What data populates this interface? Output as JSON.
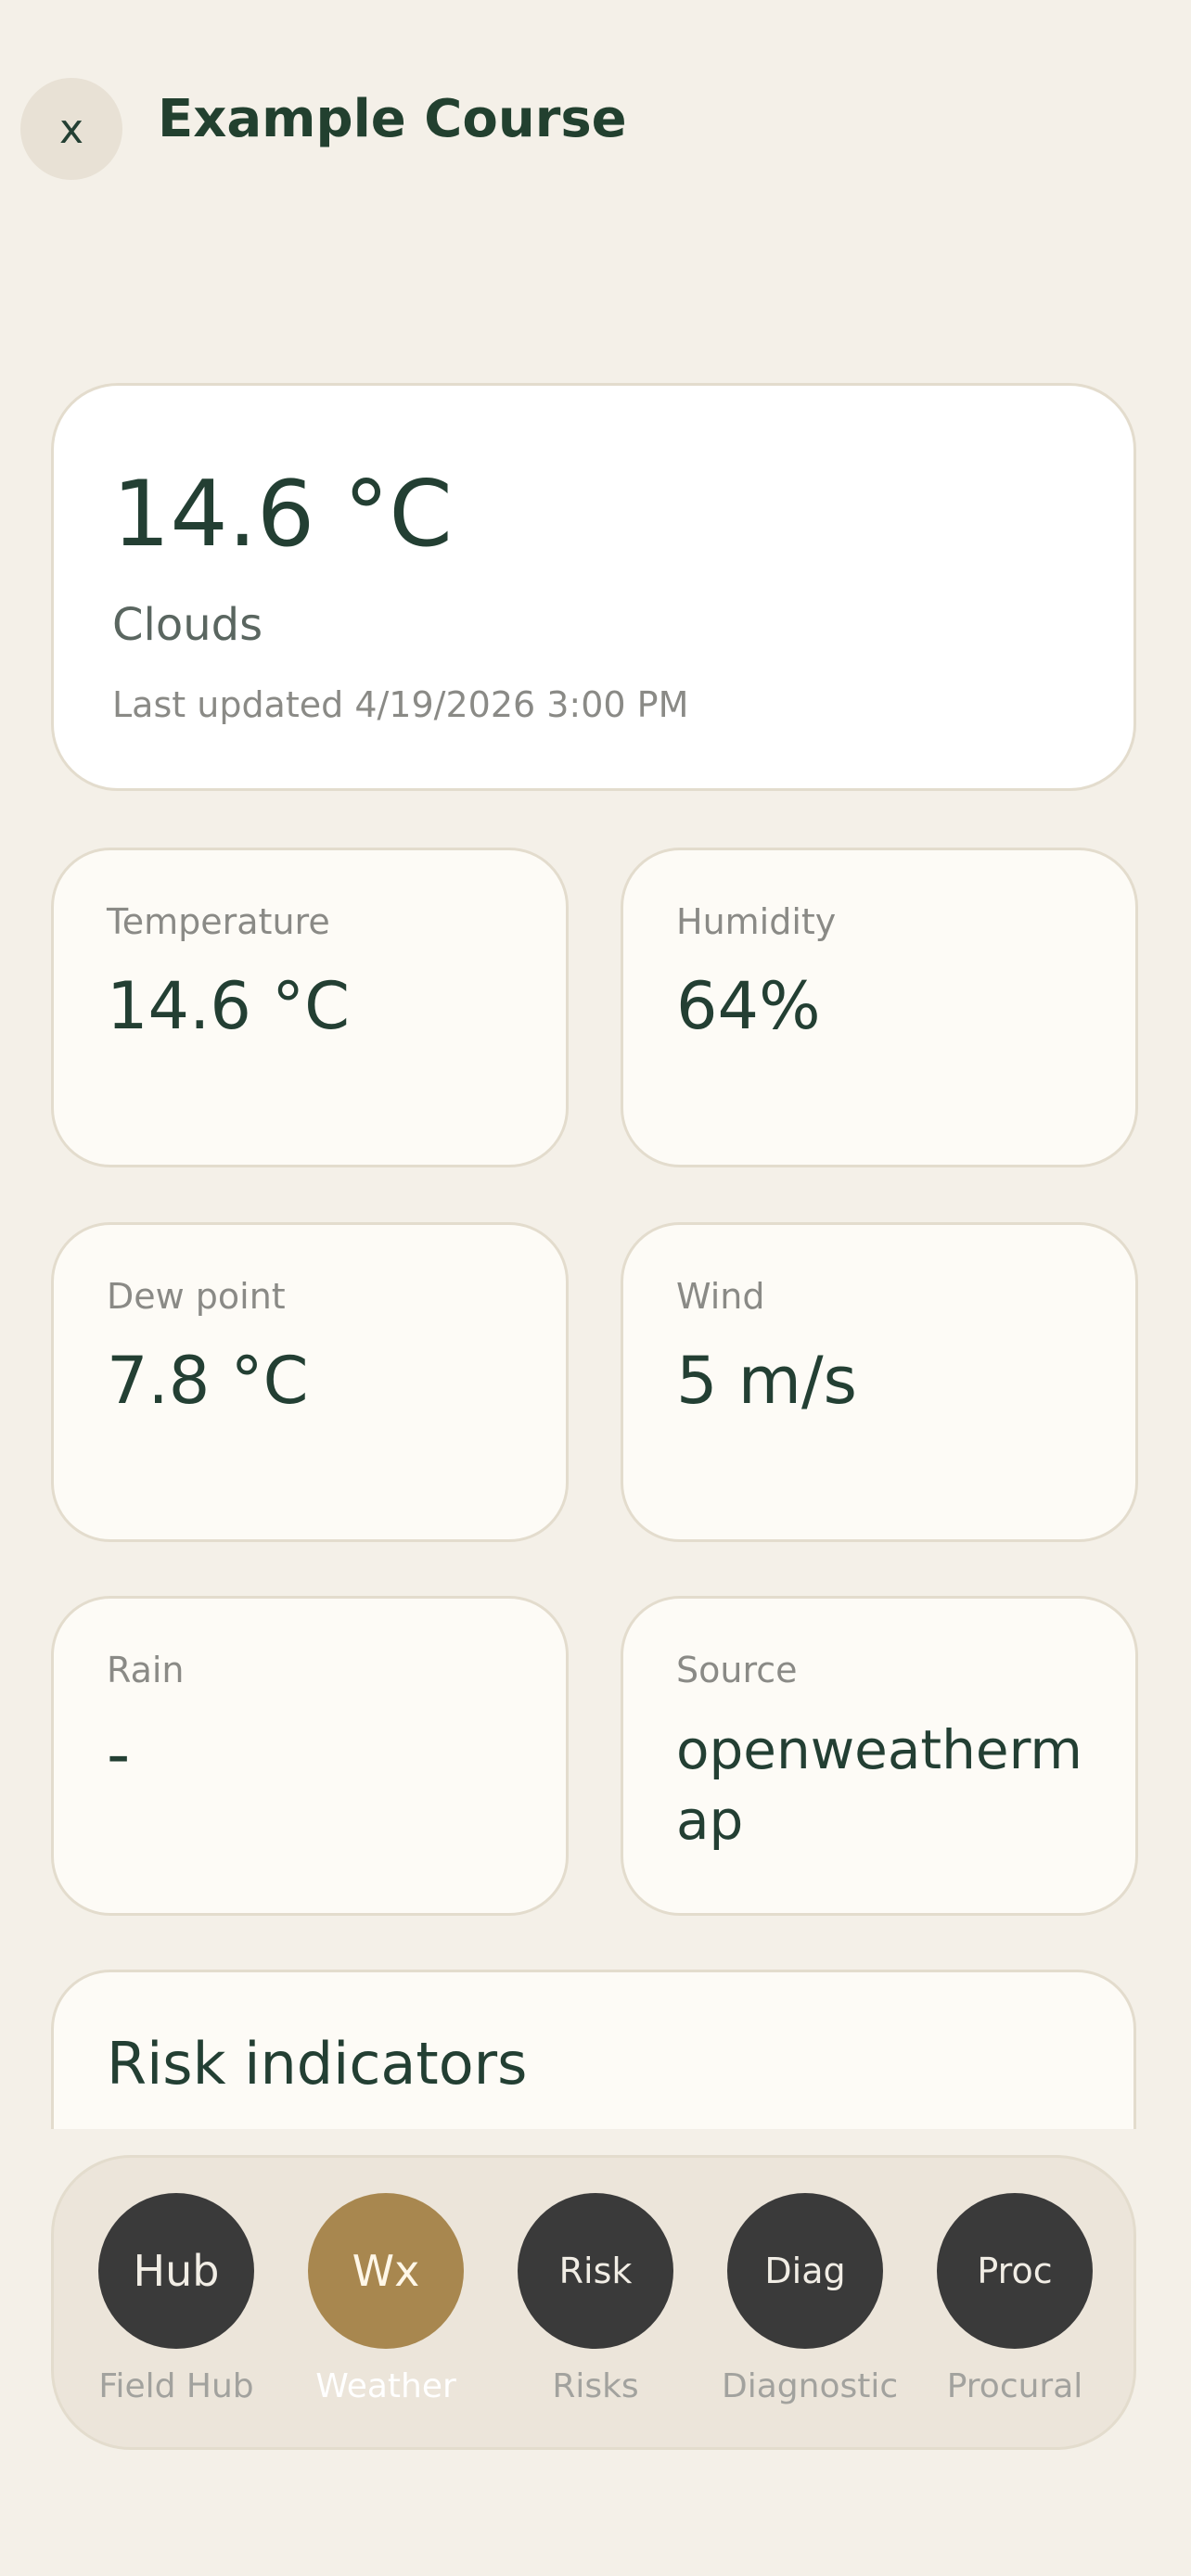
{
  "header": {
    "close_label": "x",
    "title": "Example Course"
  },
  "current": {
    "temperature": "14.6 °C",
    "condition": "Clouds",
    "last_updated": "Last updated 4/19/2026 3:00 PM"
  },
  "metrics": [
    {
      "label": "Temperature",
      "value": "14.6 °C"
    },
    {
      "label": "Humidity",
      "value": "64%"
    },
    {
      "label": "Dew point",
      "value": "7.8 °C"
    },
    {
      "label": "Wind",
      "value": "5 m/s"
    },
    {
      "label": "Rain",
      "value": "-"
    },
    {
      "label": "Source",
      "value": "openweathermap"
    }
  ],
  "risk": {
    "title": "Risk indicators"
  },
  "nav": [
    {
      "abbr": "Hub",
      "label": "Field Hub"
    },
    {
      "abbr": "Wx",
      "label": "Weather"
    },
    {
      "abbr": "Risk",
      "label": "Risks"
    },
    {
      "abbr": "Diag",
      "label": "Diagnostic"
    },
    {
      "abbr": "Proc",
      "label": "Procural"
    }
  ],
  "colors": {
    "accent": "#a8874f",
    "text": "#233f33",
    "background": "#f4f0e8"
  }
}
